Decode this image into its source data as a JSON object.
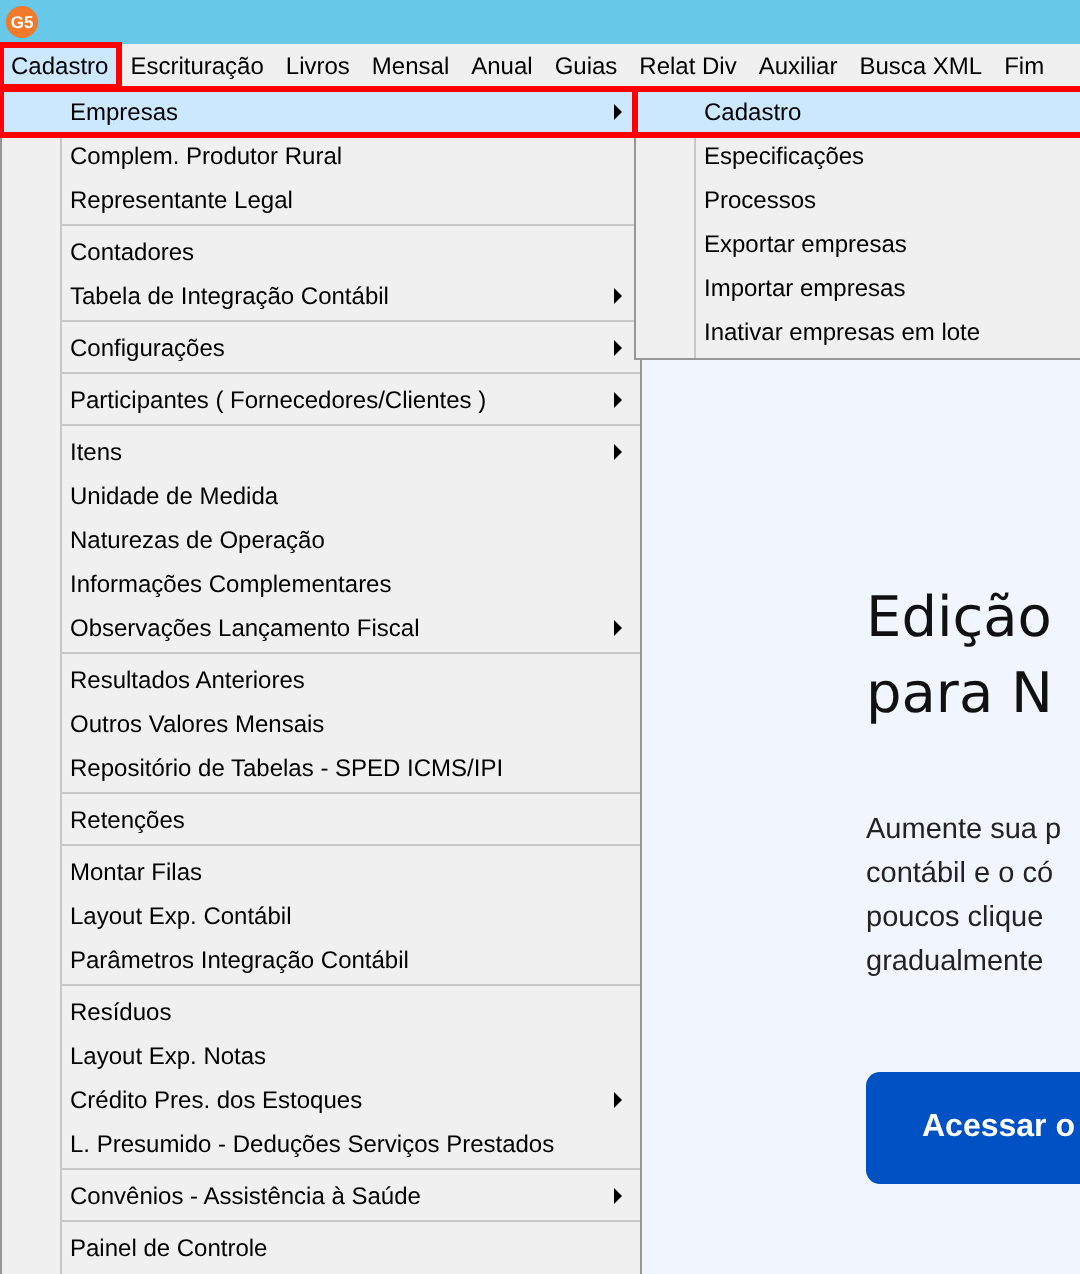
{
  "app": {
    "logo_text": "G5"
  },
  "menubar": [
    {
      "label": "Cadastro",
      "selected": true,
      "highlighted": true
    },
    {
      "label": "Escrituração",
      "selected": false,
      "highlighted": false
    },
    {
      "label": "Livros",
      "selected": false,
      "highlighted": false
    },
    {
      "label": "Mensal",
      "selected": false,
      "highlighted": false
    },
    {
      "label": "Anual",
      "selected": false,
      "highlighted": false
    },
    {
      "label": "Guias",
      "selected": false,
      "highlighted": false
    },
    {
      "label": "Relat Div",
      "selected": false,
      "highlighted": false
    },
    {
      "label": "Auxiliar",
      "selected": false,
      "highlighted": false
    },
    {
      "label": "Busca XML",
      "selected": false,
      "highlighted": false
    },
    {
      "label": "Fim",
      "selected": false,
      "highlighted": false
    }
  ],
  "menu": {
    "groups": [
      [
        {
          "label": "Empresas",
          "submenu": true,
          "selected": true,
          "highlighted": true
        },
        {
          "label": "Complem. Produtor Rural",
          "submenu": false,
          "selected": false,
          "highlighted": false
        },
        {
          "label": "Representante Legal",
          "submenu": false,
          "selected": false,
          "highlighted": false
        }
      ],
      [
        {
          "label": "Contadores",
          "submenu": false,
          "selected": false,
          "highlighted": false
        },
        {
          "label": "Tabela de Integração Contábil",
          "submenu": true,
          "selected": false,
          "highlighted": false
        }
      ],
      [
        {
          "label": "Configurações",
          "submenu": true,
          "selected": false,
          "highlighted": false
        }
      ],
      [
        {
          "label": "Participantes ( Fornecedores/Clientes )",
          "submenu": true,
          "selected": false,
          "highlighted": false
        }
      ],
      [
        {
          "label": "Itens",
          "submenu": true,
          "selected": false,
          "highlighted": false
        },
        {
          "label": "Unidade de Medida",
          "submenu": false,
          "selected": false,
          "highlighted": false
        },
        {
          "label": "Naturezas de Operação",
          "submenu": false,
          "selected": false,
          "highlighted": false
        },
        {
          "label": "Informações Complementares",
          "submenu": false,
          "selected": false,
          "highlighted": false
        },
        {
          "label": "Observações Lançamento Fiscal",
          "submenu": true,
          "selected": false,
          "highlighted": false
        }
      ],
      [
        {
          "label": "Resultados Anteriores",
          "submenu": false,
          "selected": false,
          "highlighted": false
        },
        {
          "label": "Outros Valores Mensais",
          "submenu": false,
          "selected": false,
          "highlighted": false
        },
        {
          "label": "Repositório de Tabelas - SPED ICMS/IPI",
          "submenu": false,
          "selected": false,
          "highlighted": false
        }
      ],
      [
        {
          "label": "Retenções",
          "submenu": false,
          "selected": false,
          "highlighted": false
        }
      ],
      [
        {
          "label": "Montar Filas",
          "submenu": false,
          "selected": false,
          "highlighted": false
        },
        {
          "label": "Layout Exp. Contábil",
          "submenu": false,
          "selected": false,
          "highlighted": false
        },
        {
          "label": "Parâmetros Integração Contábil",
          "submenu": false,
          "selected": false,
          "highlighted": false
        }
      ],
      [
        {
          "label": "Resíduos",
          "submenu": false,
          "selected": false,
          "highlighted": false
        },
        {
          "label": "Layout Exp. Notas",
          "submenu": false,
          "selected": false,
          "highlighted": false
        },
        {
          "label": "Crédito Pres. dos Estoques",
          "submenu": true,
          "selected": false,
          "highlighted": false
        },
        {
          "label": "L. Presumido - Deduções Serviços Prestados",
          "submenu": false,
          "selected": false,
          "highlighted": false
        }
      ],
      [
        {
          "label": "Convênios - Assistência à Saúde",
          "submenu": true,
          "selected": false,
          "highlighted": false
        }
      ],
      [
        {
          "label": "Painel de Controle",
          "submenu": false,
          "selected": false,
          "highlighted": false
        }
      ]
    ]
  },
  "submenu": {
    "groups": [
      [
        {
          "label": "Cadastro",
          "selected": true,
          "highlighted": true
        },
        {
          "label": "Especificações",
          "selected": false,
          "highlighted": false
        },
        {
          "label": "Processos",
          "selected": false,
          "highlighted": false
        },
        {
          "label": "Exportar empresas",
          "selected": false,
          "highlighted": false
        },
        {
          "label": "Importar empresas",
          "selected": false,
          "highlighted": false
        },
        {
          "label": "Inativar empresas em lote",
          "selected": false,
          "highlighted": false
        }
      ]
    ]
  },
  "page": {
    "heading_lines": [
      "Edição",
      "para N"
    ],
    "paragraph_lines": [
      "Aumente sua p",
      "contábil e o có",
      "poucos clique",
      "gradualmente"
    ],
    "button": "Acessar o"
  }
}
